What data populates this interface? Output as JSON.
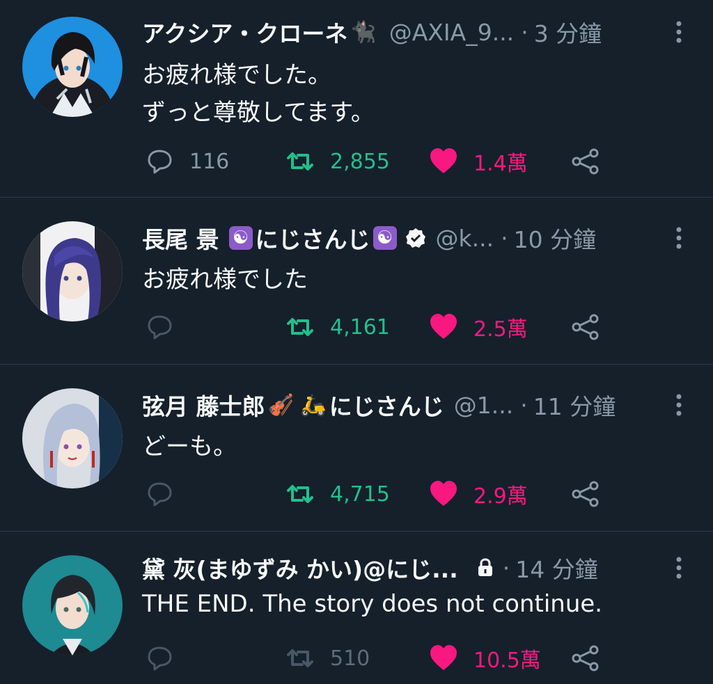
{
  "colors": {
    "background": "#15202b",
    "retweet_active": "#21c08b",
    "like_active": "#f91880",
    "muted_text": "#8b98a5"
  },
  "tweets": [
    {
      "display_name": "アクシア・クローネ",
      "name_emoji": "🐈‍⬛",
      "handle": "@AXIA_9...",
      "dot": "·",
      "time": "3 分鐘",
      "lines": [
        "お疲れ様でした。",
        "ずっと尊敬してます。"
      ],
      "reply_count": "116",
      "retweet_count": "2,855",
      "like_count": "1.4萬",
      "icons": [
        "reply-icon",
        "retweet-icon",
        "heart-icon",
        "share-icon",
        "more-icon"
      ]
    },
    {
      "display_name": "長尾 景",
      "badge_glyph": "☯",
      "name_suffix": "にじさんじ",
      "handle": "@k...",
      "dot": "·",
      "time": "10 分鐘",
      "lines": [
        "お疲れ様でした"
      ],
      "reply_count": "",
      "retweet_count": "4,161",
      "like_count": "2.5萬",
      "icons": [
        "reply-icon",
        "retweet-icon",
        "heart-icon",
        "share-icon",
        "verified-icon"
      ]
    },
    {
      "display_name": "弦月 藤士郎",
      "name_emojis": "🎻 🛵",
      "name_suffix": "にじさんじ",
      "handle": "@1...",
      "dot": "·",
      "time": "11 分鐘",
      "lines": [
        "どーも。"
      ],
      "reply_count": "",
      "retweet_count": "4,715",
      "like_count": "2.9萬",
      "icons": [
        "reply-icon",
        "retweet-icon",
        "heart-icon",
        "share-icon"
      ]
    },
    {
      "display_name": "黛 灰(まゆずみ かい)@にじ...",
      "dot": "·",
      "time": "14 分鐘",
      "lines": [
        "THE END. The story does not continue."
      ],
      "reply_count": "",
      "retweet_count": "510",
      "like_count": "10.5萬",
      "icons": [
        "reply-icon",
        "retweet-icon",
        "heart-icon",
        "share-icon",
        "lock-icon"
      ]
    }
  ]
}
